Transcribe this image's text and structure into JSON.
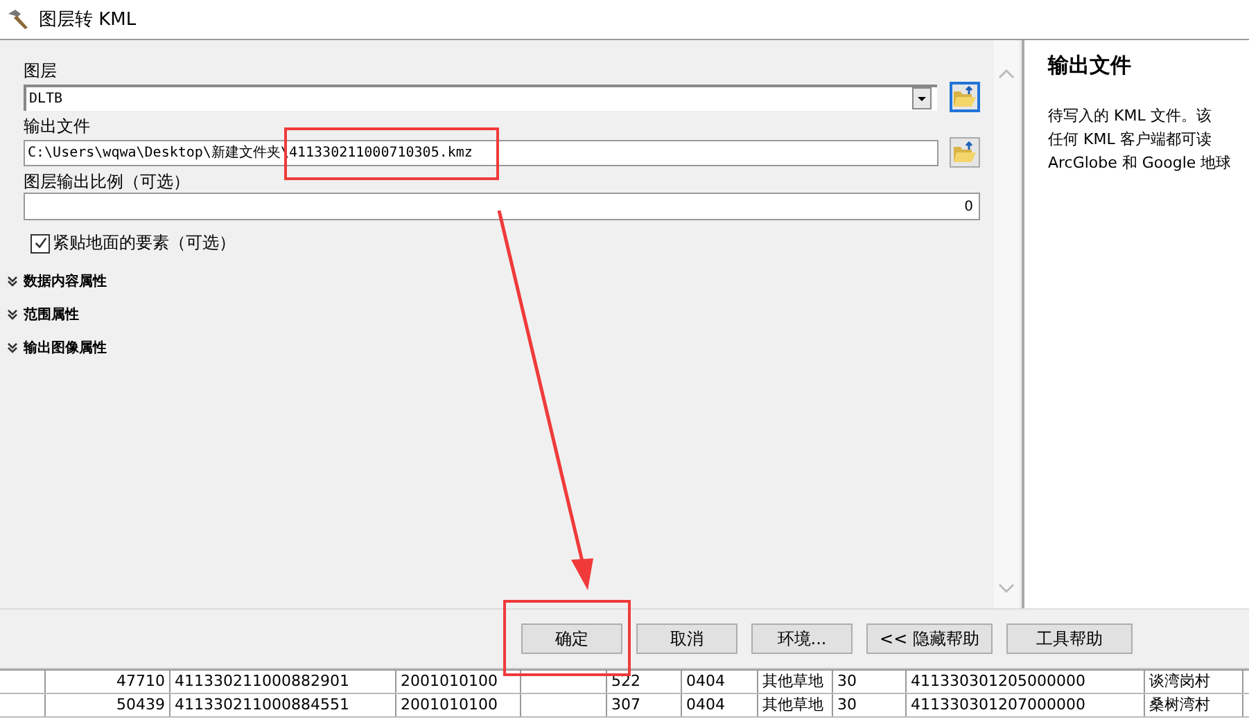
{
  "window": {
    "title": "图层转 KML"
  },
  "fields": [
    {
      "label": "图层",
      "kind": "dropdown",
      "value": "DLTB",
      "focused": true
    },
    {
      "label": "输出文件",
      "kind": "file",
      "value": "C:\\Users\\wqwa\\Desktop\\新建文件夹\\411330211000710305.kmz",
      "focused": false
    },
    {
      "label": "图层输出比例（可选）",
      "kind": "number",
      "value": "0"
    }
  ],
  "checkbox": {
    "label": "紧贴地面的要素（可选）",
    "checked": true
  },
  "sections": [
    {
      "label": "数据内容属性",
      "expanded": false
    },
    {
      "label": "范围属性",
      "expanded": false
    },
    {
      "label": "输出图像属性",
      "expanded": false
    }
  ],
  "help": {
    "title": "输出文件",
    "lines": [
      "待写入的 KML 文件。该",
      "任何 KML 客户端都可读",
      "ArcGlobe 和 Google 地球"
    ]
  },
  "buttons": [
    "确定",
    "取消",
    "环境...",
    "<< 隐藏帮助",
    "工具帮助"
  ],
  "table": {
    "rows": [
      [
        "",
        "47710",
        "411330211000882901",
        "2001010100",
        "",
        "522",
        "0404",
        "其他草地",
        "30",
        "411330301205000000",
        "谈湾岗村"
      ],
      [
        "",
        "50439",
        "411330211000884551",
        "2001010100",
        "",
        "307",
        "0404",
        "其他草地",
        "30",
        "411330301207000000",
        "桑树湾村"
      ]
    ]
  }
}
